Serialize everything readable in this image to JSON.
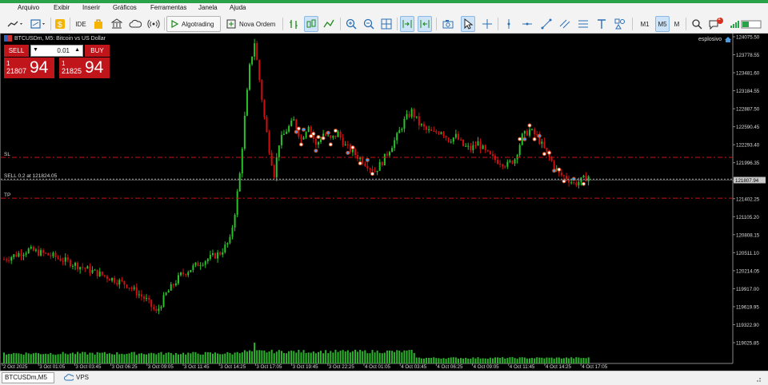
{
  "menu": [
    "Arquivo",
    "Exibir",
    "Inserir",
    "Gráficos",
    "Ferramentas",
    "Janela",
    "Ajuda"
  ],
  "toolbar": {
    "ide_label": "IDE",
    "algotrading_label": "Algotrading",
    "new_order_label": "Nova Ordem",
    "timeframes": [
      "M1",
      "M5",
      "M"
    ],
    "active_timeframe": "M5",
    "notification_count": "1"
  },
  "chart": {
    "header": "BTCUSDm, M5:  Bitcoin vs US Dollar",
    "expert_label": "esplosivo",
    "current_price": "121807.94",
    "trade_panel": {
      "sell_label": "SELL",
      "buy_label": "BUY",
      "volume": "0.01",
      "bid_small": "1",
      "bid_mid": "21807",
      "bid_big": "94",
      "ask_small": "1",
      "ask_mid": "21825",
      "ask_big": "94"
    },
    "lines": {
      "sl_label": "SL",
      "sell_label": "SELL 0.2 at 121824.05",
      "tp_label": "TP",
      "sl_price": 122170,
      "entry_price": 121824.05,
      "tp_price": 121520
    }
  },
  "chart_data": {
    "type": "candlestick",
    "y_ticks": [
      "124075.50",
      "123778.55",
      "123481.60",
      "123184.55",
      "122887.50",
      "122590.45",
      "122293.40",
      "121996.35",
      "121699.30",
      "121402.25",
      "121105.20",
      "120808.15",
      "120511.10",
      "120214.05",
      "119917.00",
      "119619.95",
      "119322.90",
      "119025.85"
    ],
    "x_ticks": [
      "2 Oct 2025",
      "3 Oct 01:05",
      "3 Oct 03:45",
      "3 Oct 06:25",
      "3 Oct 09:05",
      "3 Oct 11:45",
      "3 Oct 14:25",
      "3 Oct 17:05",
      "3 Oct 19:45",
      "3 Oct 22:25",
      "4 Oct 01:05",
      "4 Oct 03:45",
      "4 Oct 06:25",
      "4 Oct 09:05",
      "4 Oct 11:45",
      "4 Oct 14:25",
      "4 Oct 17:05"
    ],
    "ylim": [
      118960,
      124110
    ],
    "price_path": [
      [
        0,
        120550
      ],
      [
        10,
        120700
      ],
      [
        20,
        120600
      ],
      [
        30,
        120450
      ],
      [
        40,
        120300
      ],
      [
        50,
        120150
      ],
      [
        58,
        119900
      ],
      [
        62,
        119700
      ],
      [
        66,
        120000
      ],
      [
        72,
        120300
      ],
      [
        80,
        120500
      ],
      [
        88,
        120650
      ],
      [
        92,
        120850
      ],
      [
        94,
        121300
      ],
      [
        96,
        121900
      ],
      [
        98,
        122800
      ],
      [
        100,
        123600
      ],
      [
        102,
        124000
      ],
      [
        104,
        123400
      ],
      [
        106,
        122800
      ],
      [
        108,
        122300
      ],
      [
        110,
        121900
      ],
      [
        112,
        122400
      ],
      [
        115,
        122600
      ],
      [
        118,
        122750
      ],
      [
        121,
        122450
      ],
      [
        124,
        122700
      ],
      [
        127,
        122350
      ],
      [
        130,
        122550
      ],
      [
        133,
        122450
      ],
      [
        136,
        122550
      ],
      [
        139,
        122350
      ],
      [
        142,
        122250
      ],
      [
        145,
        122150
      ],
      [
        148,
        122050
      ],
      [
        151,
        121950
      ],
      [
        154,
        122100
      ],
      [
        157,
        122300
      ],
      [
        160,
        122500
      ],
      [
        163,
        122750
      ],
      [
        166,
        122900
      ],
      [
        169,
        122700
      ],
      [
        172,
        122600
      ],
      [
        175,
        122550
      ],
      [
        178,
        122600
      ],
      [
        181,
        122450
      ],
      [
        184,
        122500
      ],
      [
        187,
        122350
      ],
      [
        190,
        122300
      ],
      [
        193,
        122400
      ],
      [
        196,
        122250
      ],
      [
        199,
        122150
      ],
      [
        202,
        122100
      ],
      [
        205,
        122050
      ],
      [
        208,
        122150
      ],
      [
        211,
        122500
      ],
      [
        214,
        122600
      ],
      [
        217,
        122500
      ],
      [
        220,
        122300
      ],
      [
        223,
        122100
      ],
      [
        226,
        121900
      ],
      [
        229,
        121850
      ],
      [
        232,
        121750
      ],
      [
        235,
        121800
      ],
      [
        238,
        121870
      ]
    ],
    "volume_levels": [
      0.55,
      0.6,
      0.65,
      1.0,
      0.3
    ],
    "colors": {
      "up": "#29c229",
      "down": "#d01010",
      "volume": "#2db32d",
      "sl": "#d01010",
      "tp": "#d01010",
      "entry": "#a0a0a0"
    }
  },
  "status": {
    "chart_tab": "BTCUSDm,M5",
    "vps_label": "VPS"
  }
}
